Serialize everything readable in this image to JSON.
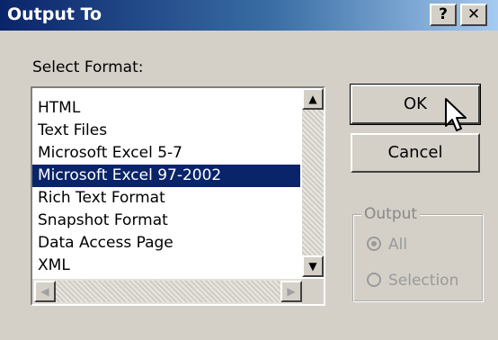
{
  "window": {
    "title": "Output To",
    "help_label": "?",
    "close_label": "✕"
  },
  "select_format_label": "Select Format:",
  "formats": [
    "HTML",
    "Text Files",
    "Microsoft Excel 5-7",
    "Microsoft Excel 97-2002",
    "Rich Text Format",
    "Snapshot Format",
    "Data Access Page",
    "XML"
  ],
  "selected_format": "Microsoft Excel 97-2002",
  "scrollbar": {
    "up": "▲",
    "down": "▼",
    "left": "◀",
    "right": "▶"
  },
  "buttons": {
    "ok": "OK",
    "cancel": "Cancel"
  },
  "output_group": {
    "title": "Output",
    "options": [
      "All",
      "Selection"
    ],
    "selected": "All"
  },
  "icons": {
    "cursor": "pointer-cursor-icon"
  }
}
